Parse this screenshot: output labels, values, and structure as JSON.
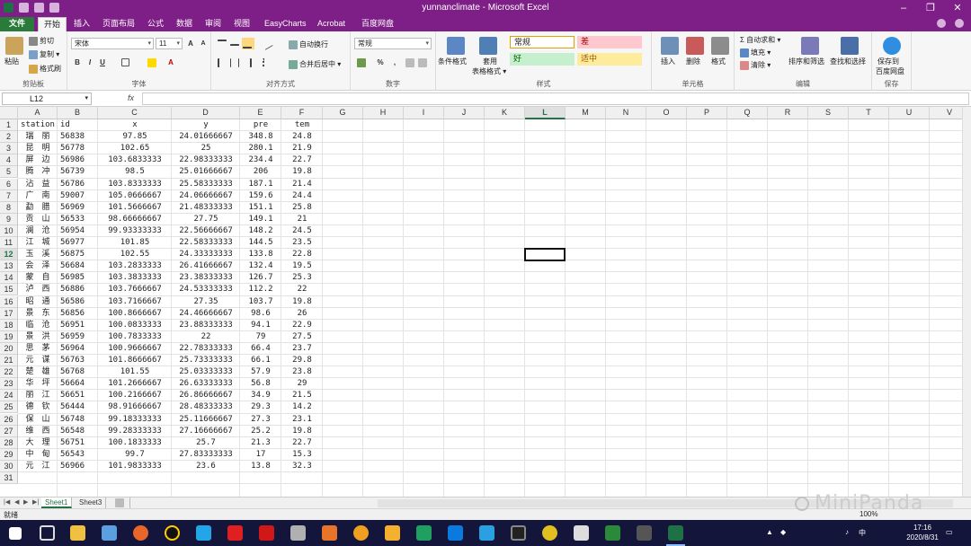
{
  "window": {
    "title": "yunnanclimate - Microsoft Excel",
    "minimize": "–",
    "restore": "❐",
    "close": "✕"
  },
  "tabs": [
    "文件",
    "开始",
    "插入",
    "页面布局",
    "公式",
    "数据",
    "审阅",
    "视图",
    "EasyCharts",
    "Acrobat",
    "百度网盘"
  ],
  "active_tab": "开始",
  "ribbon": {
    "clipboard": {
      "label": "剪贴板",
      "paste": "粘贴",
      "cut": "剪切",
      "copy": "复制 ▾",
      "painter": "格式刷"
    },
    "font": {
      "label": "字体",
      "name": "宋体",
      "size": "11",
      "grow": "A",
      "shrink": "A",
      "bold": "B",
      "italic": "I",
      "underline": "U"
    },
    "alignment": {
      "label": "对齐方式",
      "wrap": "自动换行",
      "merge": "合并后居中 ▾"
    },
    "number": {
      "label": "数字",
      "format": "常规",
      "percent": "%",
      "comma": ","
    },
    "styles": {
      "label": "样式",
      "cond": "条件格式",
      "table": "套用",
      "table2": "表格格式 ▾",
      "normal": "常规",
      "bad": "差",
      "good": "好",
      "neutral": "适中"
    },
    "cells": {
      "label": "单元格",
      "insert": "插入",
      "delete": "删除",
      "format": "格式"
    },
    "editing": {
      "label": "编辑",
      "autosum": "Σ 自动求和 ▾",
      "fill": "填充 ▾",
      "clear": "清除 ▾",
      "sort": "排序和筛选",
      "find": "查找和选择"
    },
    "save": {
      "label": "保存",
      "save1": "保存到",
      "save2": "百度网盘"
    }
  },
  "formula_bar": {
    "name_box": "L12",
    "fx": "fx",
    "value": ""
  },
  "columns": [
    "A",
    "B",
    "C",
    "D",
    "E",
    "F",
    "G",
    "H",
    "I",
    "J",
    "K",
    "L",
    "M",
    "N",
    "O",
    "P",
    "Q",
    "R",
    "S",
    "T",
    "U",
    "V"
  ],
  "selected_cell": {
    "col": "L",
    "row": 12
  },
  "table": {
    "headers": [
      "station",
      "id",
      "x",
      "y",
      "pre",
      "tem"
    ],
    "rows": [
      [
        "瑞　丽",
        "56838",
        "97.85",
        "24.01666667",
        "348.8",
        "24.8"
      ],
      [
        "昆　明",
        "56778",
        "102.65",
        "25",
        "280.1",
        "21.9"
      ],
      [
        "屏　边",
        "56986",
        "103.6833333",
        "22.98333333",
        "234.4",
        "22.7"
      ],
      [
        "腾　冲",
        "56739",
        "98.5",
        "25.01666667",
        "206",
        "19.8"
      ],
      [
        "沾　益",
        "56786",
        "103.8333333",
        "25.58333333",
        "187.1",
        "21.4"
      ],
      [
        "广　南",
        "59007",
        "105.0666667",
        "24.06666667",
        "159.6",
        "24.4"
      ],
      [
        "勐　腊",
        "56969",
        "101.5666667",
        "21.48333333",
        "151.1",
        "25.8"
      ],
      [
        "贡　山",
        "56533",
        "98.66666667",
        "27.75",
        "149.1",
        "21"
      ],
      [
        "澜　沧",
        "56954",
        "99.93333333",
        "22.56666667",
        "148.2",
        "24.5"
      ],
      [
        "江　城",
        "56977",
        "101.85",
        "22.58333333",
        "144.5",
        "23.5"
      ],
      [
        "玉　溪",
        "56875",
        "102.55",
        "24.33333333",
        "133.8",
        "22.8"
      ],
      [
        "会　泽",
        "56684",
        "103.2833333",
        "26.41666667",
        "132.4",
        "19.5"
      ],
      [
        "蒙　自",
        "56985",
        "103.3833333",
        "23.38333333",
        "126.7",
        "25.3"
      ],
      [
        "泸　西",
        "56886",
        "103.7666667",
        "24.53333333",
        "112.2",
        "22"
      ],
      [
        "昭　通",
        "56586",
        "103.7166667",
        "27.35",
        "103.7",
        "19.8"
      ],
      [
        "景　东",
        "56856",
        "100.8666667",
        "24.46666667",
        "98.6",
        "26"
      ],
      [
        "临　沧",
        "56951",
        "100.0833333",
        "23.88333333",
        "94.1",
        "22.9"
      ],
      [
        "景　洪",
        "56959",
        "100.7833333",
        "22",
        "79",
        "27.5"
      ],
      [
        "思　茅",
        "56964",
        "100.9666667",
        "22.78333333",
        "66.4",
        "23.7"
      ],
      [
        "元　谋",
        "56763",
        "101.8666667",
        "25.73333333",
        "66.1",
        "29.8"
      ],
      [
        "楚　雄",
        "56768",
        "101.55",
        "25.03333333",
        "57.9",
        "23.8"
      ],
      [
        "华　坪",
        "56664",
        "101.2666667",
        "26.63333333",
        "56.8",
        "29"
      ],
      [
        "丽　江",
        "56651",
        "100.2166667",
        "26.86666667",
        "34.9",
        "21.5"
      ],
      [
        "德　钦",
        "56444",
        "98.91666667",
        "28.48333333",
        "29.3",
        "14.2"
      ],
      [
        "保　山",
        "56748",
        "99.18333333",
        "25.11666667",
        "27.3",
        "23.1"
      ],
      [
        "维　西",
        "56548",
        "99.28333333",
        "27.16666667",
        "25.2",
        "19.8"
      ],
      [
        "大　理",
        "56751",
        "100.1833333",
        "25.7",
        "21.3",
        "22.7"
      ],
      [
        "中　甸",
        "56543",
        "99.7",
        "27.83333333",
        "17",
        "15.3"
      ],
      [
        "元　江",
        "56966",
        "101.9833333",
        "23.6",
        "13.8",
        "32.3"
      ]
    ]
  },
  "sheets": [
    "Sheet1",
    "Sheet3"
  ],
  "status": {
    "ready": "就绪",
    "zoom": "100%"
  },
  "watermark": "MiniPanda",
  "taskbar": {
    "time": "17:16",
    "date": "2020/8/31",
    "ime": "中"
  }
}
